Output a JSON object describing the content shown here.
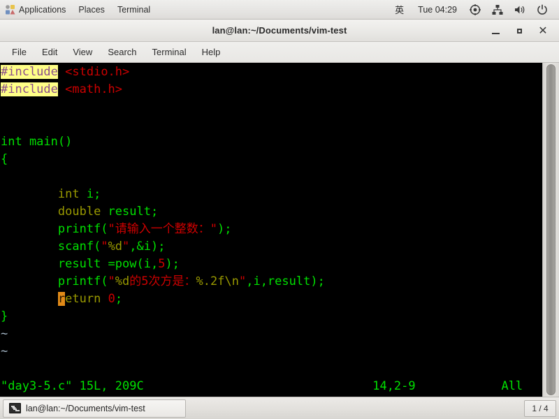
{
  "top_panel": {
    "menus": [
      {
        "label": "Applications",
        "icon": "applications-icon"
      },
      {
        "label": "Places",
        "icon": null
      },
      {
        "label": "Terminal",
        "icon": null
      }
    ],
    "tray": {
      "input_method": "英",
      "clock": "Tue 04:29",
      "icons": [
        "target-icon",
        "network-icon",
        "volume-icon",
        "power-icon"
      ]
    }
  },
  "window": {
    "title": "lan@lan:~/Documents/vim-test",
    "buttons": {
      "minimize": "minimize-button",
      "maximize": "maximize-button",
      "close": "close-button"
    }
  },
  "menubar": {
    "items": [
      "File",
      "Edit",
      "View",
      "Search",
      "Terminal",
      "Help"
    ]
  },
  "terminal": {
    "background": "#000000",
    "colors": {
      "green": "#00e000",
      "red": "#cc0000",
      "olive": "#999900",
      "purple": "#9a5f9a",
      "blue_gray": "#a6b8c8",
      "search_highlight_bg": "#ffff87",
      "cursor_bg": "#e08a18"
    },
    "lines": [
      {
        "segments": [
          {
            "text": "#include",
            "class": "hl-search"
          },
          {
            "text": " ",
            "class": "c-white"
          },
          {
            "text": "<stdio.h>",
            "class": "c-red"
          }
        ]
      },
      {
        "segments": [
          {
            "text": "#include",
            "class": "hl-search"
          },
          {
            "text": " ",
            "class": "c-white"
          },
          {
            "text": "<math.h>",
            "class": "c-red"
          }
        ]
      },
      {
        "segments": []
      },
      {
        "segments": []
      },
      {
        "segments": [
          {
            "text": "int main()",
            "class": "c-green"
          }
        ]
      },
      {
        "segments": [
          {
            "text": "{",
            "class": "c-green"
          }
        ]
      },
      {
        "segments": []
      },
      {
        "segments": [
          {
            "text": "        ",
            "class": "c-white"
          },
          {
            "text": "int",
            "class": "c-olive"
          },
          {
            "text": " i;",
            "class": "c-green"
          }
        ]
      },
      {
        "segments": [
          {
            "text": "        ",
            "class": "c-white"
          },
          {
            "text": "double",
            "class": "c-olive"
          },
          {
            "text": " result;",
            "class": "c-green"
          }
        ]
      },
      {
        "segments": [
          {
            "text": "        ",
            "class": "c-white"
          },
          {
            "text": "printf(",
            "class": "c-green"
          },
          {
            "text": "\"请输入一个整数：\"",
            "class": "c-red"
          },
          {
            "text": ");",
            "class": "c-green"
          }
        ]
      },
      {
        "segments": [
          {
            "text": "        ",
            "class": "c-white"
          },
          {
            "text": "scanf(",
            "class": "c-green"
          },
          {
            "text": "\"",
            "class": "c-red"
          },
          {
            "text": "%d",
            "class": "c-olive"
          },
          {
            "text": "\"",
            "class": "c-red"
          },
          {
            "text": ",&i);",
            "class": "c-green"
          }
        ]
      },
      {
        "segments": [
          {
            "text": "        ",
            "class": "c-white"
          },
          {
            "text": "result =pow(i,",
            "class": "c-green"
          },
          {
            "text": "5",
            "class": "c-red"
          },
          {
            "text": ");",
            "class": "c-green"
          }
        ]
      },
      {
        "segments": [
          {
            "text": "        ",
            "class": "c-white"
          },
          {
            "text": "printf(",
            "class": "c-green"
          },
          {
            "text": "\"",
            "class": "c-red"
          },
          {
            "text": "%d",
            "class": "c-olive"
          },
          {
            "text": "的5次方是：",
            "class": "c-red"
          },
          {
            "text": "%.2f",
            "class": "c-olive"
          },
          {
            "text": "\\n",
            "class": "c-olive"
          },
          {
            "text": "\"",
            "class": "c-red"
          },
          {
            "text": ",i,result);",
            "class": "c-green"
          }
        ]
      },
      {
        "segments": [
          {
            "text": "        ",
            "class": "c-white"
          },
          {
            "text": "r",
            "class": "cursor"
          },
          {
            "text": "eturn",
            "class": "c-olive"
          },
          {
            "text": " ",
            "class": "c-green"
          },
          {
            "text": "0",
            "class": "c-red"
          },
          {
            "text": ";",
            "class": "c-green"
          }
        ]
      },
      {
        "segments": [
          {
            "text": "}",
            "class": "c-green"
          }
        ]
      },
      {
        "segments": [
          {
            "text": "~",
            "class": "c-blue"
          }
        ]
      },
      {
        "segments": [
          {
            "text": "~",
            "class": "c-blue"
          }
        ]
      }
    ],
    "status_line": {
      "file_info": "\"day3-5.c\" 15L, 209C",
      "position": "14,2-9",
      "scroll": "All"
    },
    "scrollbar": "vertical-scrollbar"
  },
  "bottom_panel": {
    "task_title": "lan@lan:~/Documents/vim-test",
    "task_icon": "terminal-icon",
    "workspace": "1 / 4"
  }
}
